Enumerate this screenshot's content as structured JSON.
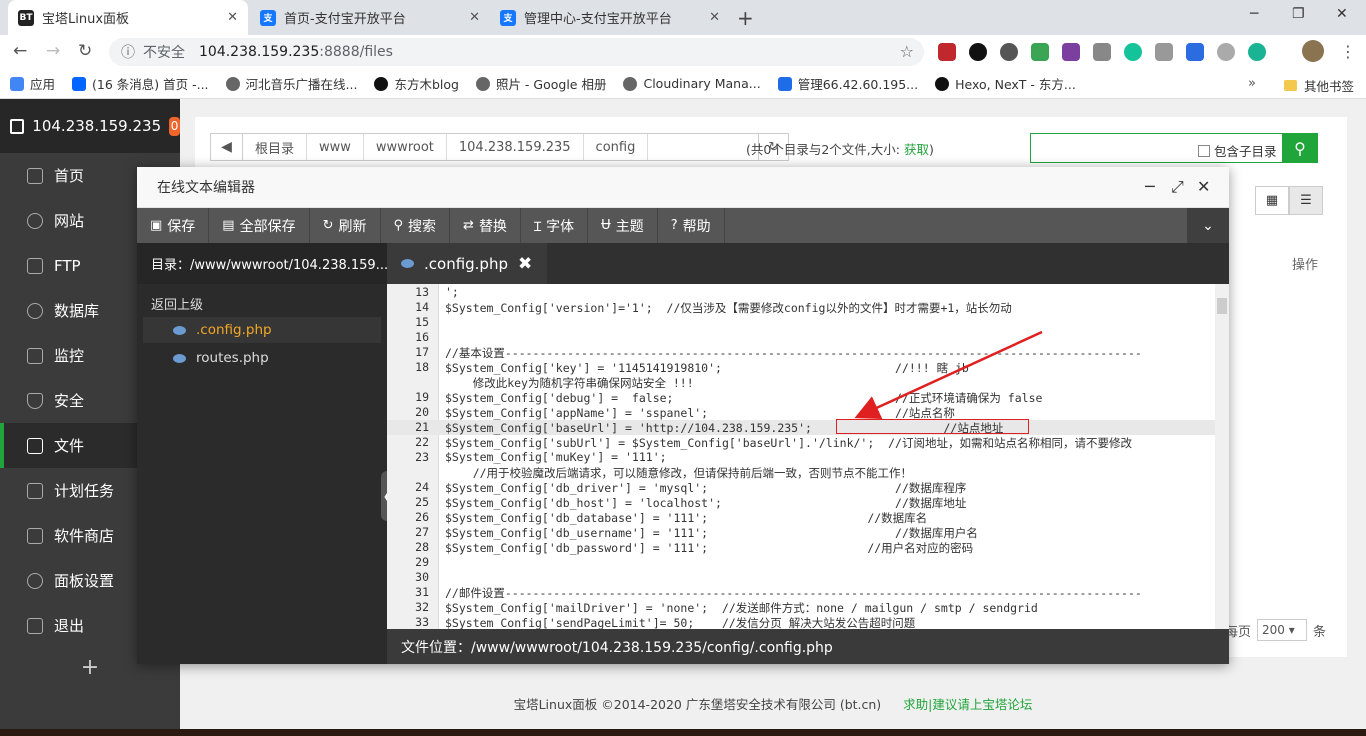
{
  "browser": {
    "tabs": [
      {
        "label": "宝塔Linux面板",
        "favicon": "BT"
      },
      {
        "label": "首页-支付宝开放平台",
        "favicon": "支"
      },
      {
        "label": "管理中心-支付宝开放平台",
        "favicon": "支"
      }
    ],
    "new_tab": "+",
    "security_label": "不安全",
    "url_host": "104.238.159.235",
    "url_path": ":8888/files",
    "bookmarks": [
      "应用",
      "(16 条消息) 首页 -...",
      "河北音乐广播在线...",
      "东方木blog",
      "照片 - Google 相册",
      "Cloudinary Mana...",
      "管理66.42.60.195...",
      "Hexo, NexT - 东方..."
    ],
    "bookmarks_more": "»",
    "other_bookmarks": "其他书签"
  },
  "sidebar": {
    "host": "104.238.159.235",
    "badge": "0",
    "items": [
      {
        "label": "首页",
        "icon": "home-icon"
      },
      {
        "label": "网站",
        "icon": "globe-icon"
      },
      {
        "label": "FTP",
        "icon": "ftp-icon"
      },
      {
        "label": "数据库",
        "icon": "database-icon"
      },
      {
        "label": "监控",
        "icon": "monitor-icon"
      },
      {
        "label": "安全",
        "icon": "shield-icon"
      },
      {
        "label": "文件",
        "icon": "folder-icon",
        "active": true
      },
      {
        "label": "计划任务",
        "icon": "calendar-icon"
      },
      {
        "label": "软件商店",
        "icon": "grid-icon"
      },
      {
        "label": "面板设置",
        "icon": "gear-icon"
      },
      {
        "label": "退出",
        "icon": "logout-icon"
      }
    ],
    "add": "+"
  },
  "files": {
    "breadcrumbs": [
      "根目录",
      "www",
      "wwwroot",
      "104.238.159.235",
      "config"
    ],
    "summary": "(共0个目录与2个文件,大小:",
    "summary_get": "获取",
    "summary_close": ")",
    "include_subdir": "包含子目录",
    "col_op": "操作",
    "per_page_prefix": "每页",
    "per_page_value": "200",
    "per_page_suffix": "条"
  },
  "editor": {
    "title": "在线文本编辑器",
    "toolbar": [
      {
        "label": "保存",
        "icon": "save-icon"
      },
      {
        "label": "全部保存",
        "icon": "save-all-icon"
      },
      {
        "label": "刷新",
        "icon": "refresh-icon"
      },
      {
        "label": "搜索",
        "icon": "search-icon"
      },
      {
        "label": "替换",
        "icon": "replace-icon"
      },
      {
        "label": "字体",
        "icon": "font-icon"
      },
      {
        "label": "主题",
        "icon": "theme-icon"
      },
      {
        "label": "帮助",
        "icon": "help-icon"
      }
    ],
    "dir_label": "目录：/www/wwwroot/104.238.159....",
    "back_label": "返回上级",
    "files": [
      ".config.php",
      "routes.php"
    ],
    "active_tab": ".config.php",
    "file_path": "文件位置：/www/wwwroot/104.238.159.235/config/.config.php",
    "code_lines": [
      {
        "n": "13",
        "t": "';"
      },
      {
        "n": "14",
        "t": "$System_Config['version']='1';  //仅当涉及【需要修改config以外的文件】时才需要+1，站长勿动"
      },
      {
        "n": "15",
        "t": ""
      },
      {
        "n": "16",
        "t": ""
      },
      {
        "n": "17",
        "t": "//基本设置--------------------------------------------------------------------------------------------"
      },
      {
        "n": "18",
        "t": "$System_Config['key'] = '1145141919810';                         //!!! 瞎 jb"
      },
      {
        "n": "",
        "t": "    修改此key为随机字符串确保网站安全 !!!"
      },
      {
        "n": "19",
        "t": "$System_Config['debug'] =  false;                                //正式环境请确保为 false"
      },
      {
        "n": "20",
        "t": "$System_Config['appName'] = 'sspanel';                           //站点名称"
      },
      {
        "n": "21",
        "t": "$System_Config['baseUrl'] = 'http://104.238.159.235';                   //站点地址"
      },
      {
        "n": "22",
        "t": "$System_Config['subUrl'] = $System_Config['baseUrl'].'/link/';  //订阅地址，如需和站点名称相同，请不要修改"
      },
      {
        "n": "23",
        "t": "$System_Config['muKey'] = '111';"
      },
      {
        "n": "",
        "t": "    //用于校验魔改后端请求，可以随意修改，但请保持前后端一致，否则节点不能工作！"
      },
      {
        "n": "24",
        "t": "$System_Config['db_driver'] = 'mysql';                           //数据库程序"
      },
      {
        "n": "25",
        "t": "$System_Config['db_host'] = 'localhost';                         //数据库地址"
      },
      {
        "n": "26",
        "t": "$System_Config['db_database'] = '111';                       //数据库名"
      },
      {
        "n": "27",
        "t": "$System_Config['db_username'] = '111';                           //数据库用户名"
      },
      {
        "n": "28",
        "t": "$System_Config['db_password'] = '111';                       //用户名对应的密码"
      },
      {
        "n": "29",
        "t": ""
      },
      {
        "n": "30",
        "t": ""
      },
      {
        "n": "31",
        "t": "//邮件设置--------------------------------------------------------------------------------------------"
      },
      {
        "n": "32",
        "t": "$System_Config['mailDriver'] = 'none';  //发送邮件方式：none / mailgun / smtp / sendgrid"
      },
      {
        "n": "33",
        "t": "$System_Config['sendPageLimit']= 50;    //发信分页 解决大站发公告超时问题"
      }
    ]
  },
  "footer": {
    "copyright": "宝塔Linux面板 ©2014-2020 广东堡塔安全技术有限公司 (bt.cn)",
    "link": "求助|建议请上宝塔论坛"
  }
}
